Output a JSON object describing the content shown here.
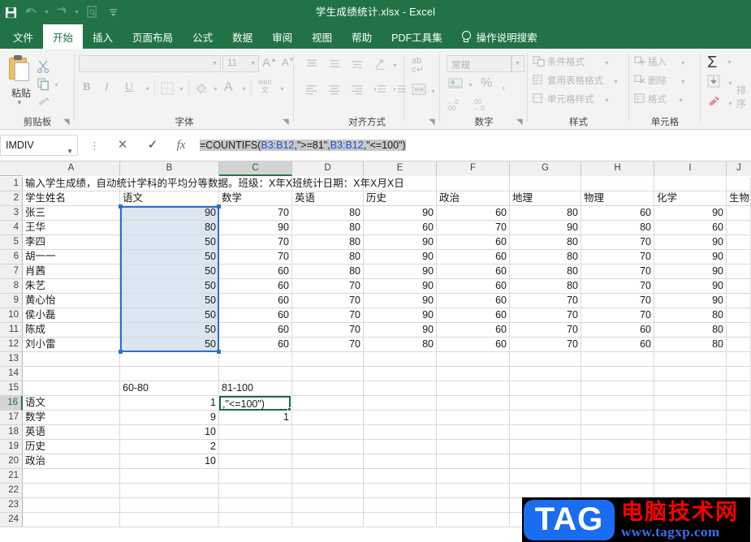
{
  "title_bar": {
    "document_title": "学生成绩统计.xlsx  -  Excel",
    "quick_access": [
      {
        "name": "save",
        "glyph": "💾"
      },
      {
        "name": "undo",
        "glyph": "↶"
      },
      {
        "name": "redo",
        "glyph": "↷"
      },
      {
        "name": "print-preview",
        "glyph": "⌗"
      },
      {
        "name": "customize",
        "glyph": "≡"
      }
    ]
  },
  "ribbon": {
    "tabs": [
      {
        "label": "文件",
        "active": false
      },
      {
        "label": "开始",
        "active": true
      },
      {
        "label": "插入",
        "active": false
      },
      {
        "label": "页面布局",
        "active": false
      },
      {
        "label": "公式",
        "active": false
      },
      {
        "label": "数据",
        "active": false
      },
      {
        "label": "审阅",
        "active": false
      },
      {
        "label": "视图",
        "active": false
      },
      {
        "label": "帮助",
        "active": false
      },
      {
        "label": "PDF工具集",
        "active": false
      }
    ],
    "tell_me": "操作说明搜索",
    "groups": {
      "clipboard": {
        "label": "剪贴板",
        "paste_label": "粘贴"
      },
      "font": {
        "label": "字体",
        "font_name": "",
        "font_size": "11",
        "bold": "B",
        "italic": "I",
        "underline": "U",
        "grow_font": "A",
        "shrink_font": "A",
        "font_color": "A",
        "phonetic": "wén\n文"
      },
      "alignment": {
        "label": "对齐方式"
      },
      "number": {
        "label": "数字",
        "format": "常规",
        "percent": "%",
        "comma": ","
      },
      "styles": {
        "label": "样式",
        "conditional_formatting": "条件格式",
        "format_as_table": "套用表格格式",
        "cell_styles": "单元格样式"
      },
      "cells": {
        "label": "单元格",
        "insert": "插入",
        "delete": "删除",
        "format": "格式"
      },
      "editing": {
        "label": "排序",
        "autosum": "Σ"
      }
    }
  },
  "formula_bar": {
    "name_box": "IMDIV",
    "cancel": "✕",
    "enter": "✓",
    "insert_function": "fx",
    "formula_parts": [
      {
        "text": "=COUNTIFS(",
        "color": "black"
      },
      {
        "text": "B3:B12",
        "color": "blue"
      },
      {
        "text": ",\">=81\",",
        "color": "black"
      },
      {
        "text": "B3:B12",
        "color": "blue"
      },
      {
        "text": ",\"<=100\")",
        "color": "black"
      }
    ],
    "formula_full": "=COUNTIFS(B3:B12,\">=81\",B3:B12,\"<=100\")"
  },
  "sheet": {
    "column_headers": [
      "A",
      "B",
      "C",
      "D",
      "E",
      "F",
      "G",
      "H",
      "I",
      "J"
    ],
    "selected_column": "C",
    "selected_row": "16",
    "row_headers": [
      "1",
      "2",
      "3",
      "4",
      "5",
      "6",
      "7",
      "8",
      "9",
      "10",
      "11",
      "12",
      "13",
      "14",
      "15",
      "16",
      "17",
      "18",
      "19",
      "20",
      "21",
      "22",
      "23",
      "24"
    ],
    "row1_note": "输入学生成绩，自动统计学科的平均分等数据。班级：X年X班统计日期：X年X月X日",
    "header_row": [
      "学生姓名",
      "语文",
      "数学",
      "英语",
      "历史",
      "政治",
      "地理",
      "物理",
      "化学",
      "生物"
    ],
    "students": [
      {
        "name": "张三",
        "scores": [
          90,
          70,
          80,
          90,
          60,
          80,
          60,
          90
        ]
      },
      {
        "name": "王华",
        "scores": [
          80,
          90,
          80,
          60,
          70,
          90,
          80,
          60
        ]
      },
      {
        "name": "李四",
        "scores": [
          50,
          70,
          80,
          90,
          60,
          80,
          70,
          90
        ]
      },
      {
        "name": "胡一一",
        "scores": [
          50,
          70,
          80,
          90,
          60,
          80,
          70,
          90
        ]
      },
      {
        "name": "肖茜",
        "scores": [
          50,
          60,
          80,
          90,
          60,
          80,
          70,
          90
        ]
      },
      {
        "name": "朱艺",
        "scores": [
          50,
          60,
          70,
          90,
          60,
          80,
          70,
          90
        ]
      },
      {
        "name": "黄心怡",
        "scores": [
          50,
          60,
          70,
          90,
          60,
          70,
          70,
          90
        ]
      },
      {
        "name": "侯小磊",
        "scores": [
          50,
          60,
          70,
          90,
          60,
          70,
          70,
          80
        ]
      },
      {
        "name": "陈成",
        "scores": [
          50,
          60,
          70,
          90,
          60,
          70,
          60,
          80
        ]
      },
      {
        "name": "刘小雷",
        "scores": [
          50,
          60,
          70,
          80,
          60,
          70,
          60,
          80
        ]
      }
    ],
    "summary": {
      "range_label_1": "60-80",
      "range_label_2": "81-100",
      "rows": [
        {
          "subject": "语文",
          "count_60_80": "1",
          "count_81_100": ""
        },
        {
          "subject": "数学",
          "count_60_80": "9",
          "count_81_100": "1"
        },
        {
          "subject": "英语",
          "count_60_80": "10",
          "count_81_100": ""
        },
        {
          "subject": "历史",
          "count_60_80": "2",
          "count_81_100": ""
        },
        {
          "subject": "政治",
          "count_60_80": "10",
          "count_81_100": ""
        }
      ]
    },
    "editing_cell": {
      "address": "C16",
      "visible_text": ",\"<=100\")"
    }
  },
  "watermark": {
    "badge": "TAG",
    "site_name": "电脑技术网",
    "url": "www.tagxp.com"
  }
}
